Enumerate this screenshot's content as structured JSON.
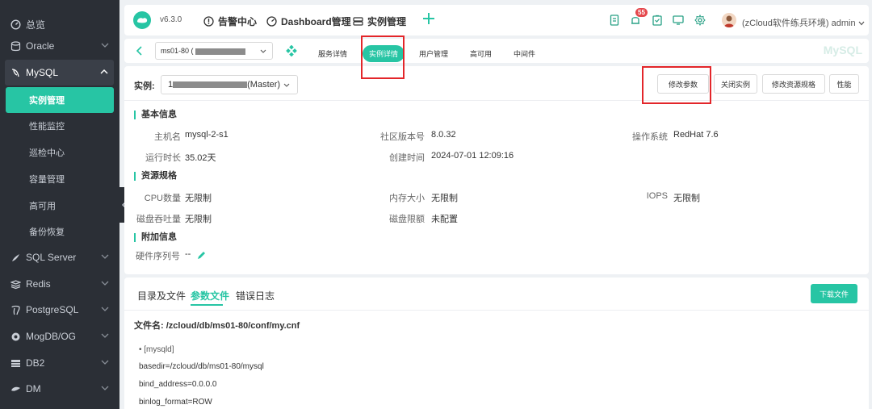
{
  "sidebar": {
    "items": [
      {
        "label": "总览",
        "icon": "gauge-icon"
      },
      {
        "label": "Oracle",
        "icon": "database-icon"
      },
      {
        "label": "MySQL",
        "icon": "dolphin-icon"
      },
      {
        "label": "SQL Server",
        "icon": "sqlserver-icon"
      },
      {
        "label": "Redis",
        "icon": "redis-icon"
      },
      {
        "label": "PostgreSQL",
        "icon": "elephant-icon"
      },
      {
        "label": "MogDB/OG",
        "icon": "mogdb-icon"
      },
      {
        "label": "DB2",
        "icon": "db2-icon"
      },
      {
        "label": "DM",
        "icon": "dm-icon"
      }
    ],
    "mysql_sub": [
      "实例管理",
      "性能监控",
      "巡检中心",
      "容量管理",
      "高可用",
      "备份恢复"
    ]
  },
  "topbar": {
    "version": "v6.3.0",
    "menu": [
      "告警中心",
      "Dashboard管理",
      "实例管理"
    ],
    "notification_count": "55",
    "user": "(zCloud软件练兵环境) admin"
  },
  "subnav": {
    "instance": "ms01-80 (",
    "tabs": [
      "服务详情",
      "实例详情",
      "用户管理",
      "高可用",
      "中间件"
    ],
    "active_tab": "实例详情",
    "db_type": "MySQL"
  },
  "panel": {
    "instance_label": "实例:",
    "instance_value_prefix": "1",
    "instance_value_suffix": "(Master)",
    "buttons": [
      "修改参数",
      "关闭实例",
      "修改资源规格",
      "性能"
    ],
    "basic_title": "基本信息",
    "basic": {
      "hostname_k": "主机名",
      "hostname_v": "mysql-2-s1",
      "version_k": "社区版本号",
      "version_v": "8.0.32",
      "os_k": "操作系统",
      "os_v": "RedHat 7.6",
      "uptime_k": "运行时长",
      "uptime_v": "35.02天",
      "created_k": "创建时间",
      "created_v": "2024-07-01 12:09:16"
    },
    "resource_title": "资源规格",
    "resource": {
      "cpu_k": "CPU数量",
      "cpu_v": "无限制",
      "mem_k": "内存大小",
      "mem_v": "无限制",
      "iops_k": "IOPS",
      "iops_v": "无限制",
      "disk_k": "磁盘吞吐量",
      "disk_v": "无限制",
      "quota_k": "磁盘限额",
      "quota_v": "未配置"
    },
    "extra_title": "附加信息",
    "extra": {
      "serial_k": "硬件序列号",
      "serial_v": "--"
    }
  },
  "bottom": {
    "tabs": [
      "目录及文件",
      "参数文件",
      "错误日志"
    ],
    "active_tab": "参数文件",
    "download": "下载文件",
    "file_label": "文件名:",
    "file_path": "/zcloud/db/ms01-80/conf/my.cnf",
    "section": "[mysqld]",
    "lines": [
      "basedir=/zcloud/db/ms01-80/mysql",
      "bind_address=0.0.0.0",
      "binlog_format=ROW"
    ]
  },
  "colors": {
    "accent": "#27c5a4",
    "sidebar": "#2b2f36",
    "highlight": "#e3262a"
  }
}
